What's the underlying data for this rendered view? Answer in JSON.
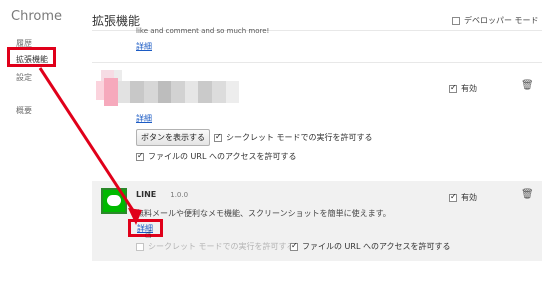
{
  "sidebar": {
    "title": "Chrome",
    "items": [
      {
        "label": "履歴"
      },
      {
        "label": "拡張機能"
      },
      {
        "label": "設定"
      },
      {
        "label": "概要"
      }
    ]
  },
  "header": {
    "title": "拡張機能",
    "dev_mode_label": "デベロッパー モード"
  },
  "extensions": [
    {
      "description": "like and comment and so much more!",
      "details_label": "詳細"
    },
    {
      "details_label": "詳細",
      "enabled_label": "有効",
      "show_button_label": "ボタンを表示する",
      "incognito_label": "シークレット モードでの実行を許可する",
      "file_url_label": "ファイルの URL へのアクセスを許可する"
    },
    {
      "name": "LINE",
      "version": "1.0.0",
      "description": "無料メールや便利なメモ機能、スクリーンショットを簡単に使えます。",
      "details_label": "詳細",
      "enabled_label": "有効",
      "incognito_label": "シークレット モードでの実行を許可する",
      "file_url_label": "ファイルの URL へのアクセスを許可する"
    }
  ],
  "colors": {
    "highlight": "#e0001a",
    "link": "#1c5bc4",
    "line_green": "#00b900"
  }
}
